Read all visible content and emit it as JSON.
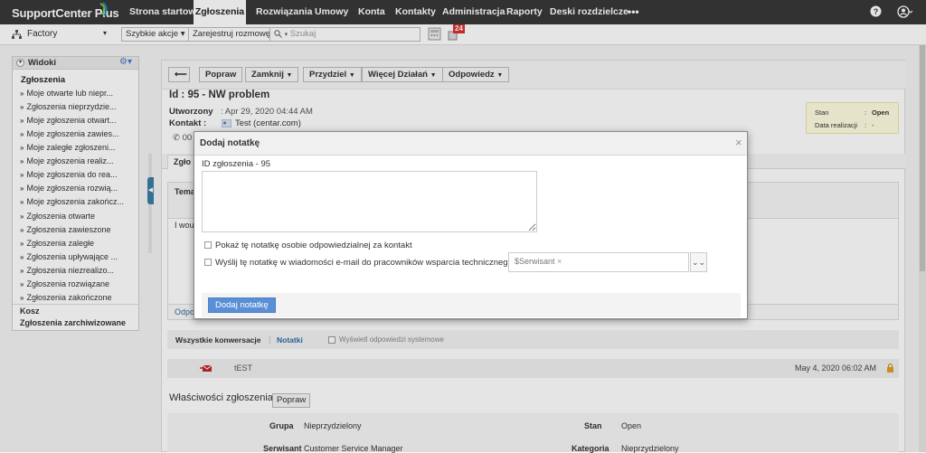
{
  "app": {
    "logo": "SupportCenter Plus"
  },
  "nav": {
    "tabs": [
      "Strona startowa",
      "Zgłoszenia",
      "Rozwiązania",
      "Umowy",
      "Konta",
      "Kontakty",
      "Administracja",
      "Raporty",
      "Deski rozdzielcze"
    ],
    "more": "•••"
  },
  "toolbar": {
    "account": "Factory",
    "quick_actions": "Szybkie akcje",
    "log_call": "Zarejestruj rozmowę",
    "search_placeholder": "Szukaj",
    "badge_count": "24"
  },
  "sidebar": {
    "title": "Widoki",
    "section": "Zgłoszenia",
    "items": [
      "Moje otwarte lub niepr...",
      "Zgłoszenia nieprzydzie...",
      "Moje zgłoszenia otwart...",
      "Moje zgłoszenia zawies...",
      "Moje zaległe zgłoszeni...",
      "Moje zgłoszenia realiz...",
      "Moje zgłoszenia do rea...",
      "Moje zgłoszenia rozwią...",
      "Moje zgłoszenia zakończ...",
      "Zgłoszenia otwarte",
      "Zgłoszenia zawieszone",
      "Zgłoszenia zaległe",
      "Zgłoszenia upływające ...",
      "Zgłoszenia niezrealizo...",
      "Zgłoszenia rozwiązane",
      "Zgłoszenia zakończone"
    ],
    "trash": "Kosz",
    "archived": "Zgłoszenia zarchiwizowane"
  },
  "actions": {
    "back": "⟵",
    "edit": "Popraw",
    "close": "Zamknij",
    "assign": "Przydziel",
    "more": "Więcej Działań",
    "reply": "Odpowiedz"
  },
  "ticket": {
    "title": "Id : 95 - NW problem",
    "created_label": "Utworzony",
    "created_value": ": Apr 29, 2020 04:44 AM",
    "contact_label": "Kontakt :",
    "contact_value": "Test (centar.com)",
    "phone_partial": "00",
    "tab_partial": "Zgło",
    "subject_partial": "Tema",
    "body_partial": "I wou",
    "reply_partial": "Odpo",
    "status_label": "Stan",
    "status_value": "Open",
    "due_label": "Data realizacji",
    "due_value": "-"
  },
  "conversations": {
    "all": "Wszystkie konwersacje",
    "notes": "Notatki",
    "show_system": "Wyświetl odpowiedzi systemowe",
    "entry_subject": "tEST",
    "entry_date": "May 4, 2020 06:02 AM"
  },
  "properties": {
    "title": "Właściwości zgłoszenia",
    "edit": "Popraw",
    "group_label": "Grupa",
    "group_value": "Nieprzydzielony",
    "status_label": "Stan",
    "status_value": "Open",
    "engineer_partial": "Serwisant",
    "engineer_value_partial": "Customer Service Manager",
    "category_partial": "Kategoria",
    "category_value_partial": "Nieprzydzielony"
  },
  "modal": {
    "title": "Dodaj notatkę",
    "close": "×",
    "ticket_id": "ID zgłoszenia - 95",
    "note_value": "",
    "show_to_owner": "Pokaż tę notatkę osobie odpowiedzialnej za kontakt",
    "email_engineers": "Wyślij tę notatkę w wiadomości e-mail do pracowników wsparcia technicznego",
    "recipient_token": "$Serwisant",
    "submit": "Dodaj notatkę"
  },
  "colors": {
    "nav_bg": "#383838",
    "accent_blue": "#2e6da4",
    "button_blue": "#5a8fd6",
    "note_yellow": "#fffde0"
  }
}
